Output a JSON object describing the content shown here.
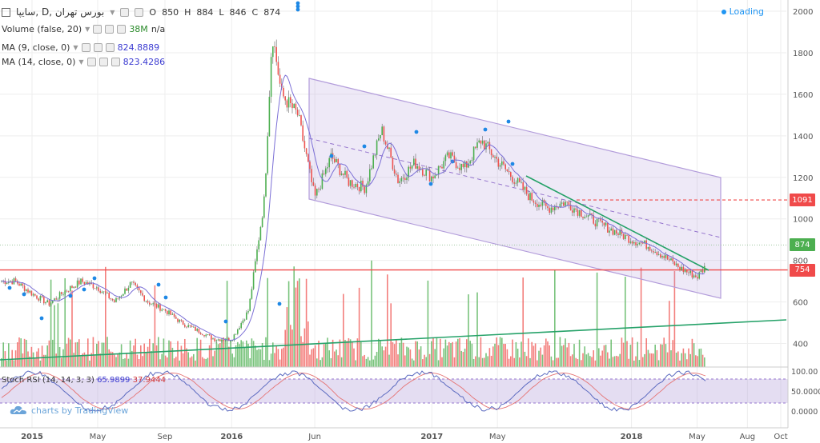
{
  "header": {
    "symbol": "سايپا, D, بورس تهران",
    "ohlc": {
      "o_label": "O",
      "o": "850",
      "h_label": "H",
      "h": "884",
      "l_label": "L",
      "l": "846",
      "c_label": "C",
      "c": "874"
    },
    "indicators": [
      {
        "label": "Volume (false, 20)",
        "value": "38M",
        "extra": "n/a"
      },
      {
        "label": "MA (9, close, 0)",
        "value": "824.8889"
      },
      {
        "label": "MA (14, close, 0)",
        "value": "823.4286"
      }
    ],
    "loading": "Loading"
  },
  "rsi": {
    "label": "Stoch RSI (14, 14, 3, 3)",
    "k": "65.9899",
    "d": "37.9444",
    "ticks": [
      "100.00",
      "50.0000",
      "0.0000"
    ]
  },
  "watermark": "charts by TradingView",
  "price_tags": [
    {
      "text": "1091",
      "price": 1091,
      "color": "#f04a4a"
    },
    {
      "text": "874",
      "price": 874,
      "color": "#4caf50"
    },
    {
      "text": "754",
      "price": 754,
      "color": "#f04a4a"
    }
  ],
  "colors": {
    "up": "#4caf50",
    "down": "#ef5350",
    "ma": "#7b6fd6",
    "channel": "#b39ddb",
    "trend": "#26a269",
    "hline": "#f04a4a"
  },
  "chart_data": {
    "type": "candlestick",
    "y_ticks": [
      400,
      600,
      800,
      1000,
      1200,
      1400,
      1600,
      1800,
      2000
    ],
    "x_ticks": [
      "2015",
      "May",
      "Sep",
      "2016",
      "Jun",
      "2017",
      "May",
      "2018",
      "May",
      "Aug",
      "Oct"
    ],
    "x_tick_dates": [
      "2015-01",
      "2015-05",
      "2015-09",
      "2016-01",
      "2016-06",
      "2017-01",
      "2017-05",
      "2018-01",
      "2018-05",
      "2018-08",
      "2018-10"
    ],
    "close_path": [
      [
        "2014-12",
        700
      ],
      [
        "2015-01",
        640
      ],
      [
        "2015-02",
        590
      ],
      [
        "2015-03",
        650
      ],
      [
        "2015-04",
        700
      ],
      [
        "2015-05",
        670
      ],
      [
        "2015-06",
        600
      ],
      [
        "2015-07",
        690
      ],
      [
        "2015-08",
        600
      ],
      [
        "2015-09",
        560
      ],
      [
        "2015-10",
        500
      ],
      [
        "2015-11",
        460
      ],
      [
        "2015-12",
        420
      ],
      [
        "2016-01",
        420
      ],
      [
        "2016-02",
        560
      ],
      [
        "2016-03",
        1100
      ],
      [
        "2016-03-15",
        1900
      ],
      [
        "2016-04",
        1600
      ],
      [
        "2016-05",
        1500
      ],
      [
        "2016-06",
        1100
      ],
      [
        "2016-07",
        1300
      ],
      [
        "2016-08",
        1180
      ],
      [
        "2016-09",
        1150
      ],
      [
        "2016-10",
        1430
      ],
      [
        "2016-11",
        1180
      ],
      [
        "2016-12",
        1270
      ],
      [
        "2017-01",
        1200
      ],
      [
        "2017-02",
        1300
      ],
      [
        "2017-03",
        1240
      ],
      [
        "2017-04",
        1380
      ],
      [
        "2017-05",
        1280
      ],
      [
        "2017-06",
        1190
      ],
      [
        "2017-07",
        1100
      ],
      [
        "2017-08",
        1050
      ],
      [
        "2017-09",
        1080
      ],
      [
        "2017-10",
        1030
      ],
      [
        "2017-11",
        980
      ],
      [
        "2017-12",
        940
      ],
      [
        "2018-01",
        900
      ],
      [
        "2018-02",
        870
      ],
      [
        "2018-03",
        820
      ],
      [
        "2018-04",
        760
      ],
      [
        "2018-05",
        720
      ],
      [
        "2018-06",
        820
      ],
      [
        "2018-07",
        874
      ]
    ],
    "horizontal_lines": [
      1091,
      874,
      754
    ],
    "ylim": [
      300,
      2050
    ]
  }
}
